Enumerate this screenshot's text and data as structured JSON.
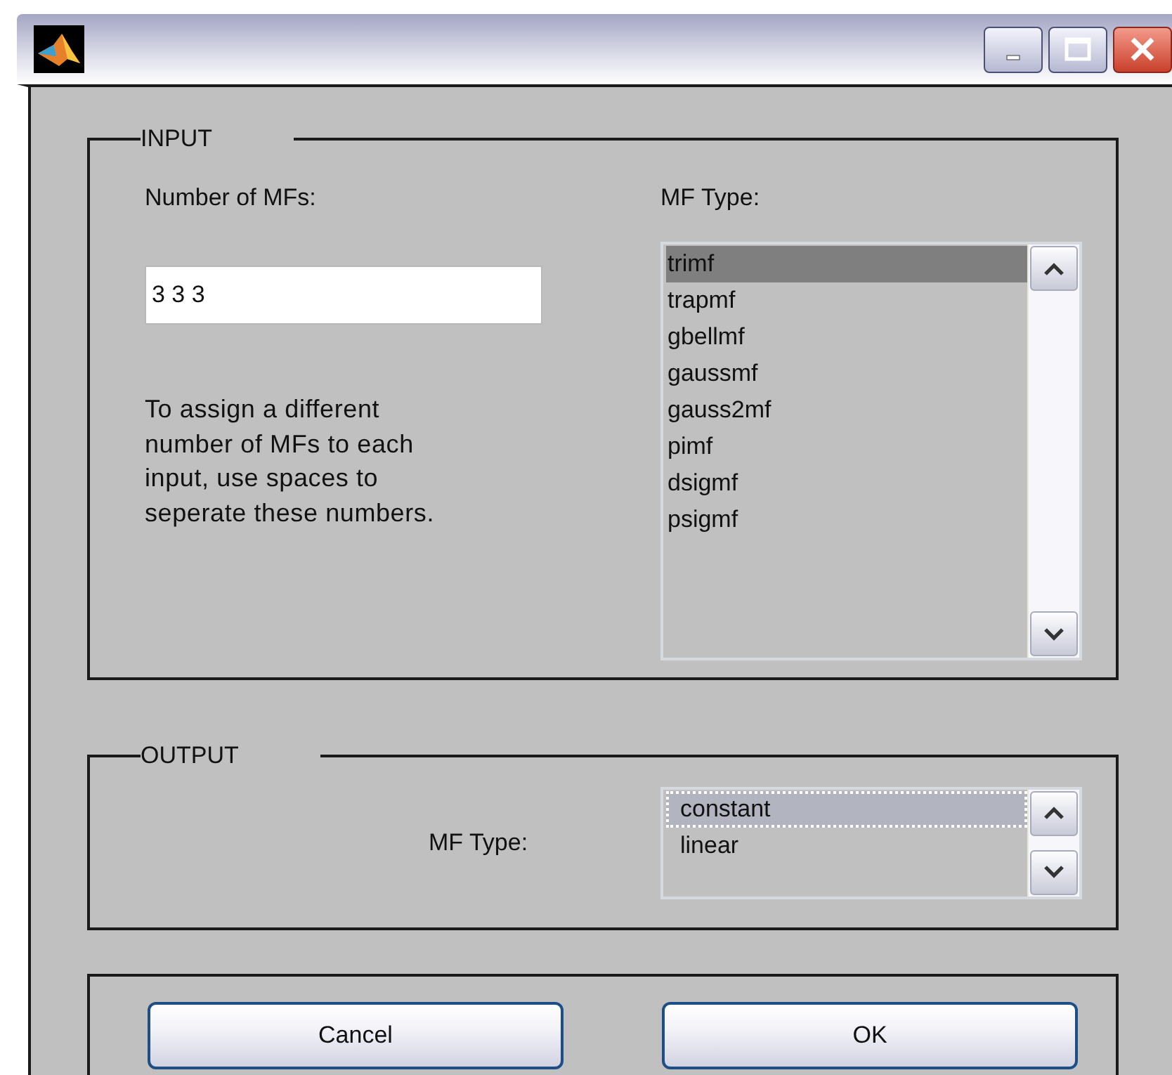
{
  "input_panel": {
    "title": "INPUT",
    "mf_count_label": "Number of MFs:",
    "mf_count_field": {
      "value": "3 3 3"
    },
    "hint": "To assign a different number of MFs to each input, use spaces to seperate these numbers.",
    "mf_type_label": "MF Type:",
    "mf_type_list": {
      "focused": false,
      "items": [
        {
          "label": "trimf",
          "selected": true
        },
        {
          "label": "trapmf",
          "selected": false
        },
        {
          "label": "gbellmf",
          "selected": false
        },
        {
          "label": "gaussmf",
          "selected": false
        },
        {
          "label": "gauss2mf",
          "selected": false
        },
        {
          "label": "pimf",
          "selected": false
        },
        {
          "label": "dsigmf",
          "selected": false
        },
        {
          "label": "psigmf",
          "selected": false
        }
      ]
    }
  },
  "output_panel": {
    "title": "OUTPUT",
    "mf_type_label": "MF Type:",
    "mf_type_list": {
      "focused": true,
      "items": [
        {
          "label": "constant",
          "selected": true
        },
        {
          "label": "linear",
          "selected": false
        }
      ]
    }
  },
  "buttons": [
    {
      "label": "Cancel"
    },
    {
      "label": "OK"
    }
  ]
}
